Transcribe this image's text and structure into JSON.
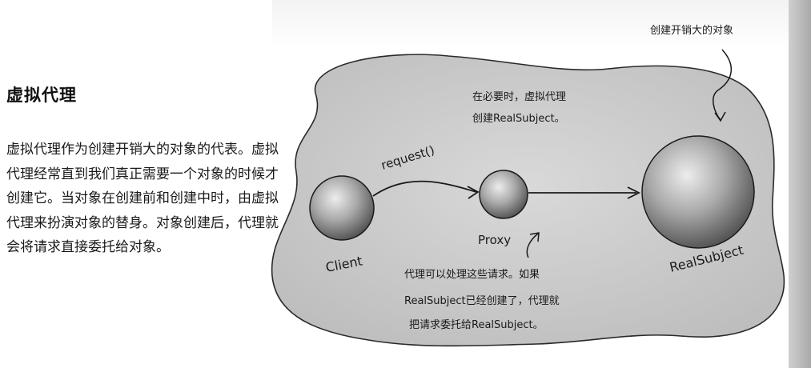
{
  "section": {
    "title": "虚拟代理",
    "body": "虚拟代理作为创建开销大的对象的代表。虚拟代理经常直到我们真正需要一个对象的时候才创建它。当对象在创建前和创建中时，由虚拟代理来扮演对象的替身。对象创建后，代理就会将请求直接委托给对象。"
  },
  "diagram": {
    "callout_top_right": "创建开销大的对象",
    "callout_center_line1": "在必要时，虚拟代理",
    "callout_center_line2": "创建RealSubject。",
    "request_label": "request()",
    "client_label": "Client",
    "proxy_label": "Proxy",
    "realsubject_label": "RealSubject",
    "callout_bottom_line1": "代理可以处理这些请求。如果",
    "callout_bottom_line2": "RealSubject已经创建了，代理就",
    "callout_bottom_line3": "把请求委托给RealSubject。"
  }
}
